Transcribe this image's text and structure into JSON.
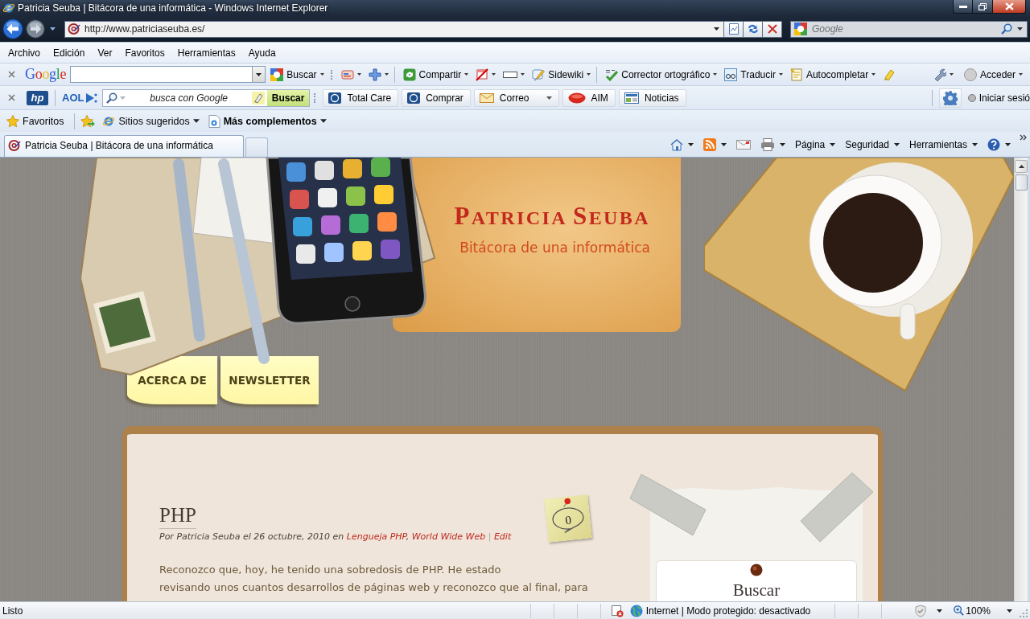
{
  "window": {
    "title": "Patricia Seuba | Bitácora de una informática - Windows Internet Explorer"
  },
  "address_bar": {
    "url": "http://www.patriciaseuba.es/"
  },
  "search_box": {
    "placeholder": "Google"
  },
  "menu_bar": [
    {
      "label": "Archivo"
    },
    {
      "label": "Edición"
    },
    {
      "label": "Ver"
    },
    {
      "label": "Favoritos"
    },
    {
      "label": "Herramientas"
    },
    {
      "label": "Ayuda"
    }
  ],
  "google_toolbar": {
    "logo": "Google",
    "items": [
      {
        "label": "Buscar",
        "dropdown": true
      },
      {
        "dropdown": true
      },
      {
        "dropdown": true
      },
      {
        "label": "Compartir",
        "dropdown": true
      },
      {
        "dropdown": true
      },
      {
        "dropdown": true
      },
      {
        "label": "Sidewiki",
        "dropdown": true
      },
      {
        "label": "Corrector ortográfico",
        "dropdown": true
      },
      {
        "label": "Traducir",
        "dropdown": true
      },
      {
        "label": "Autocompletar",
        "dropdown": true
      },
      {
        "dropdown": false
      }
    ],
    "right_items": [
      {
        "dropdown": true
      },
      {
        "label": "Acceder",
        "dropdown": true
      }
    ]
  },
  "hp_toolbar": {
    "logo": "hp",
    "aol": "AOL",
    "search": {
      "placeholder": "busca con Google",
      "button": "Buscar"
    },
    "buttons": [
      {
        "label": "Total Care",
        "dropdown": false
      },
      {
        "label": "Comprar",
        "dropdown": false
      },
      {
        "label": "Correo",
        "dropdown": true
      },
      {
        "label": "AIM",
        "dropdown": false
      },
      {
        "label": "Noticias",
        "dropdown": false
      }
    ],
    "sign_in": "Iniciar sesió"
  },
  "favorites_bar": {
    "label": "Favoritos",
    "items": [
      {
        "label": "Sitios sugeridos",
        "dropdown": true
      },
      {
        "label": "Más complementos",
        "dropdown": true
      }
    ]
  },
  "tabs": [
    {
      "title": "Patricia Seuba | Bitácora de una informática",
      "selected": true
    }
  ],
  "command_bar": [
    {
      "dropdown": true
    },
    {
      "dropdown": true
    },
    {
      "dropdown": false
    },
    {
      "dropdown": true
    },
    {
      "label": "Página",
      "dropdown": true
    },
    {
      "label": "Seguridad",
      "dropdown": true
    },
    {
      "label": "Herramientas",
      "dropdown": true
    },
    {
      "dropdown": true
    }
  ],
  "page": {
    "site_title": "PATRICIA SEUBA",
    "tagline": "Bitácora de una informática",
    "nav": [
      {
        "label": "ACERCA DE"
      },
      {
        "label": "NEWSLETTER"
      }
    ],
    "post": {
      "title": "PHP",
      "meta": [
        {
          "kind": "text",
          "text": "Por Patricia Seuba el 26 octubre, 2010 en"
        },
        {
          "kind": "link",
          "text": "Lengueja PHP"
        },
        {
          "kind": "punct",
          "text": ","
        },
        {
          "kind": "link",
          "text": "World Wide Web"
        },
        {
          "kind": "separator",
          "text": "|"
        },
        {
          "kind": "link",
          "text": "Edit"
        }
      ],
      "comments": "0",
      "body": "Reconozco que, hoy, he tenido una sobredosis de PHP. He estado\nrevisando unos cuantos desarrollos de páginas web y reconozco que al final, para"
    },
    "sidebar": {
      "widget_title": "Buscar"
    }
  },
  "status_bar": {
    "text": "Listo",
    "zone": "Internet | Modo protegido: desactivado",
    "zoom": "100%"
  }
}
